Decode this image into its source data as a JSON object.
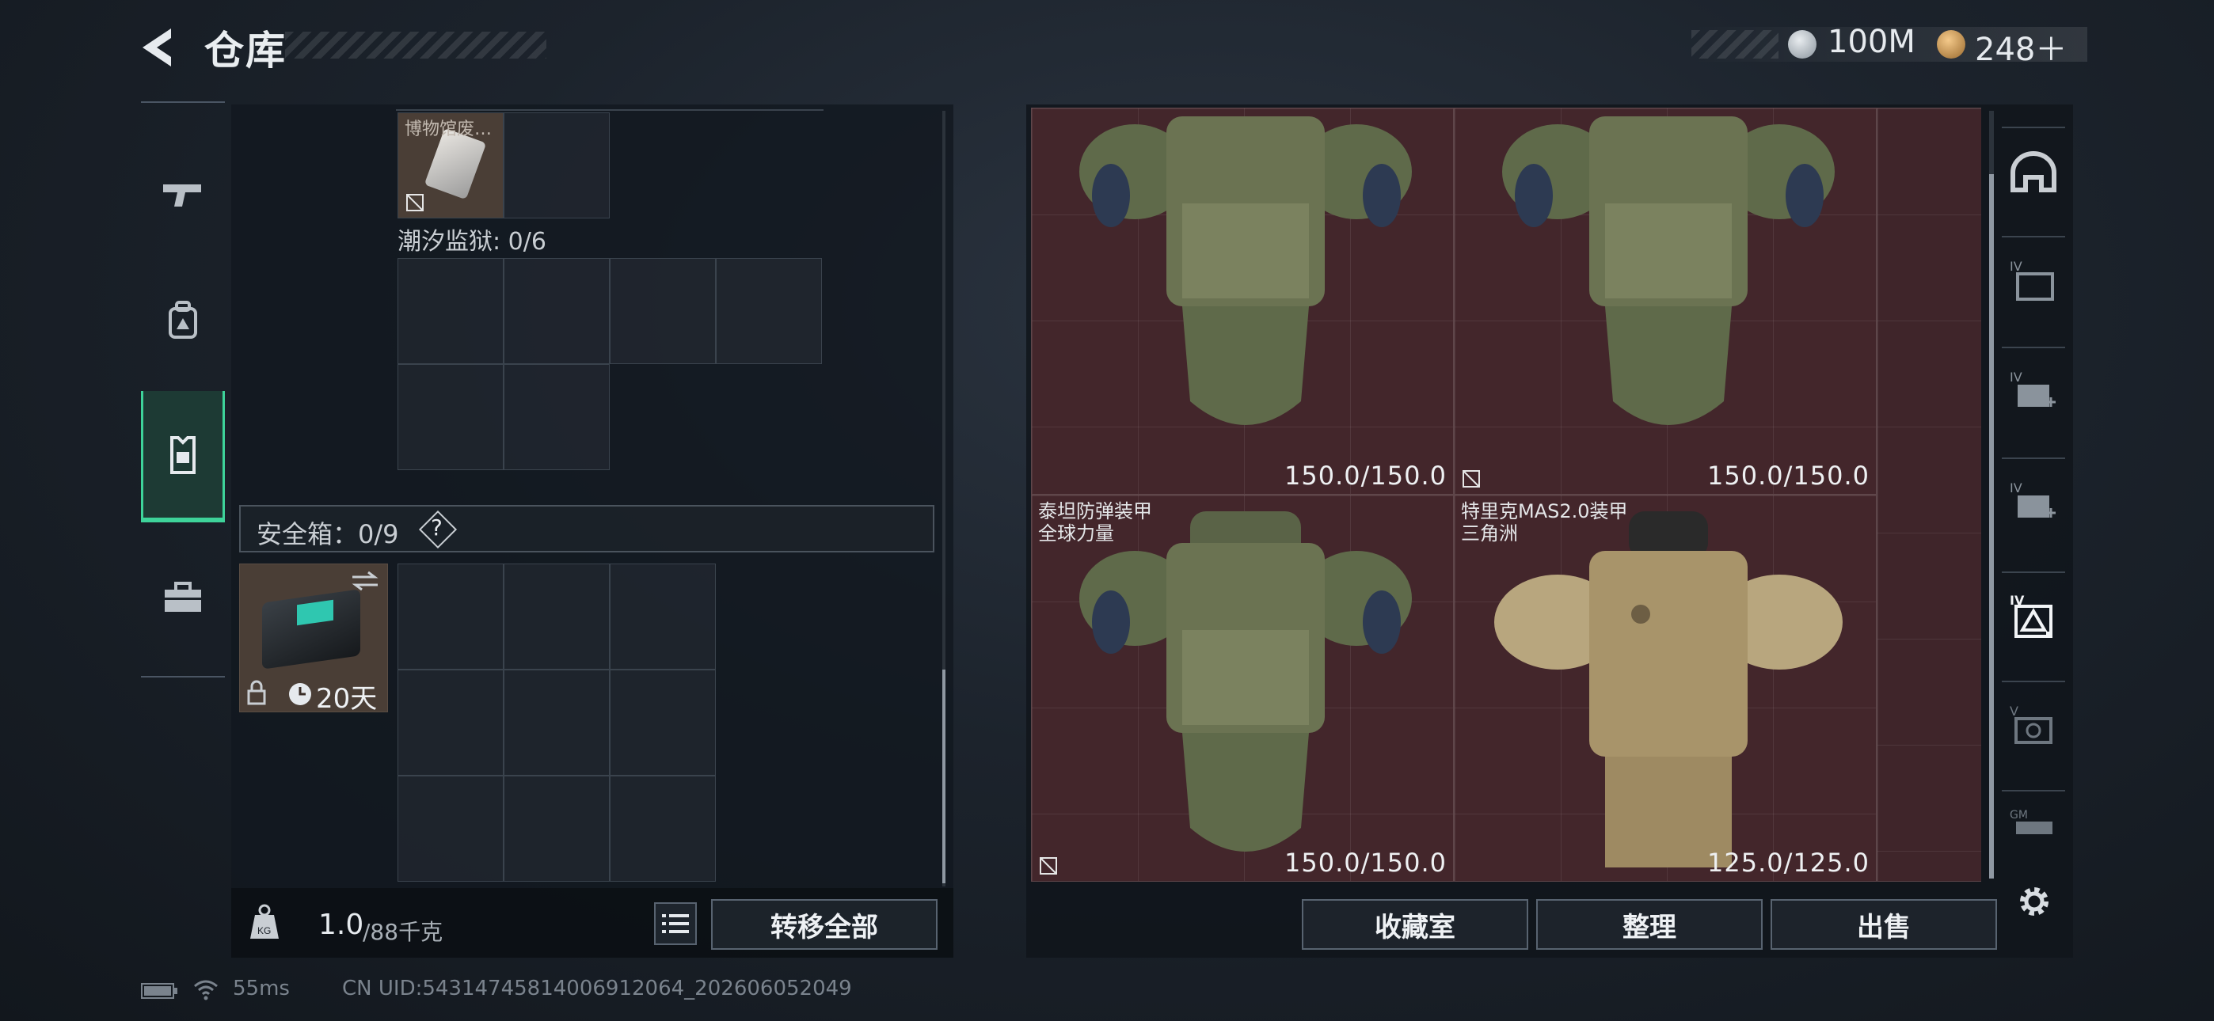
{
  "header": {
    "title": "仓库",
    "currencies": [
      {
        "icon": "silver-coin-icon",
        "value": "100M"
      },
      {
        "icon": "gold-coin-icon",
        "value": "248＋"
      }
    ]
  },
  "left_nav": [
    {
      "icon": "pistol-icon",
      "active": false
    },
    {
      "icon": "backpack-icon",
      "active": false
    },
    {
      "icon": "chest-rig-icon",
      "active": true
    },
    {
      "icon": "toolbox-icon",
      "active": false
    }
  ],
  "left_panel": {
    "top_item_label": "博物馆废…",
    "container_label": "潮汐监狱: 0/6",
    "safe_box_label": "安全箱：0/9",
    "safe_box_help": "?",
    "safe_box_time": "20天",
    "weight_value": "1.0",
    "weight_max": "/88千克",
    "transfer_all": "转移全部"
  },
  "armors": [
    {
      "name_lines": [],
      "durability": "150.0/150.0",
      "no_deploy": false
    },
    {
      "name_lines": [],
      "durability": "150.0/150.0",
      "no_deploy": false
    },
    {
      "name_lines": [
        "泰坦防弹装甲",
        "全球力量"
      ],
      "durability": "150.0/150.0",
      "no_deploy": true
    },
    {
      "name_lines": [
        "特里克MAS2.0装甲",
        "三角洲"
      ],
      "durability": "125.0/125.0",
      "no_deploy": true
    }
  ],
  "right_tabs": [
    {
      "icon": "helmet-icon"
    },
    {
      "icon": "lv4-storage-icon"
    },
    {
      "icon": "lv4-medkit-icon"
    },
    {
      "icon": "lv4-medkit-plus-icon"
    },
    {
      "icon": "lv4-armor-icon"
    },
    {
      "icon": "lv5-scope-icon"
    },
    {
      "icon": "lv6-weapon-icon"
    }
  ],
  "bottom_buttons": {
    "collection": "收藏室",
    "sort": "整理",
    "sell": "出售"
  },
  "status_bar": {
    "ping": "55ms",
    "uid": "CN UID:5431474581400691206‌4_202606052049"
  },
  "colors": {
    "accent": "#3ed39a",
    "armor_bg": "#43262b"
  }
}
